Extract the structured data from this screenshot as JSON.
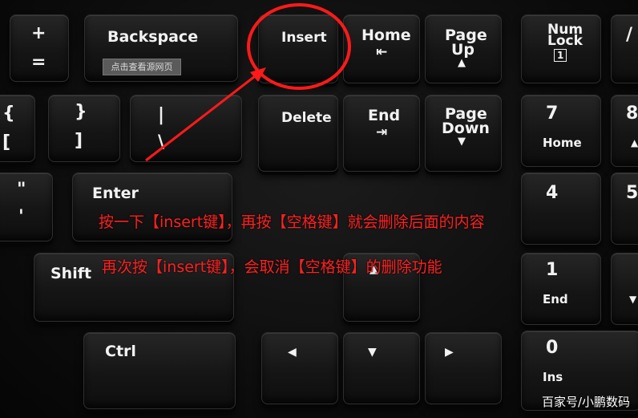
{
  "keys": {
    "plus": "+",
    "equals": "=",
    "backspace": "Backspace",
    "insert": "Insert",
    "home": "Home",
    "page_up_1": "Page",
    "page_up_2": "Up",
    "num_lock_1": "Num",
    "num_lock_2": "Lock",
    "slash": "/",
    "brace_open": "{",
    "bracket_open": "[",
    "brace_close": "}",
    "bracket_close": "]",
    "pipe": "|",
    "backslash": "\\",
    "delete": "Delete",
    "end": "End",
    "page_down_1": "Page",
    "page_down_2": "Down",
    "num7": "7",
    "num7_sub": "Home",
    "num8": "8",
    "quote_dbl": "\"",
    "quote_sgl": "'",
    "enter": "Enter",
    "num4": "4",
    "num5": "5",
    "shift": "Shift",
    "num1": "1",
    "num1_sub": "End",
    "ctrl": "Ctrl",
    "num0": "0",
    "num0_sub": "Ins"
  },
  "tooltip": "点击查看源网页",
  "annotations": {
    "line1": "按一下【insert键】，再按【空格键】就会删除后面的内容",
    "line2": "再次按【insert键】，会取消【空格键】的删除功能",
    "color": "#ff2020"
  },
  "watermark": "百家号/小鹏数码"
}
